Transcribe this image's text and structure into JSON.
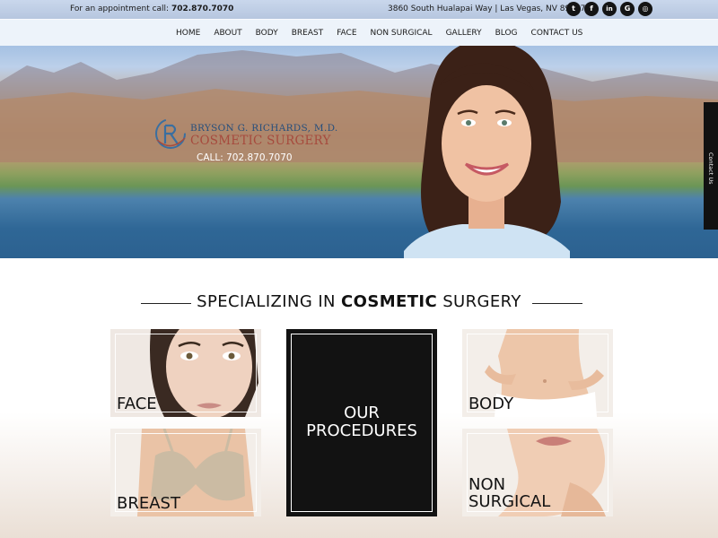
{
  "topbar": {
    "appointment_prefix": "For an appointment call: ",
    "appointment_phone": "702.870.7070",
    "address": "3860 South Hualapai Way | Las Vegas, NV 89147",
    "social": [
      {
        "name": "twitter-icon",
        "glyph": "t"
      },
      {
        "name": "facebook-icon",
        "glyph": "f"
      },
      {
        "name": "linkedin-icon",
        "glyph": "in"
      },
      {
        "name": "google-plus-icon",
        "glyph": "G"
      },
      {
        "name": "instagram-icon",
        "glyph": "◎"
      }
    ]
  },
  "nav": {
    "items": [
      "HOME",
      "ABOUT",
      "BODY",
      "BREAST",
      "FACE",
      "NON SURGICAL",
      "GALLERY",
      "BLOG",
      "CONTACT US"
    ]
  },
  "hero": {
    "logo_line1": "BRYSON G. RICHARDS, M.D.",
    "logo_line2": "COSMETIC SURGERY",
    "call": "CALL: 702.870.7070"
  },
  "contact_tab": {
    "label": "Contact Us"
  },
  "section": {
    "heading_pre": "SPECIALIZING IN ",
    "heading_bold": "COSMETIC",
    "heading_post": " SURGERY"
  },
  "cards": {
    "face": "FACE",
    "body": "BODY",
    "breast": "BREAST",
    "non_surgical_line1": "NON",
    "non_surgical_line2": "SURGICAL",
    "procedures_line1": "OUR",
    "procedures_line2": "PROCEDURES"
  },
  "colors": {
    "logo_blue": "#254e7c",
    "logo_red": "#a64a3d",
    "dark": "#121212"
  }
}
